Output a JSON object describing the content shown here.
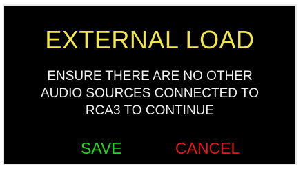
{
  "dialog": {
    "title": "EXTERNAL LOAD",
    "message_lines": [
      "ENSURE THERE ARE NO OTHER",
      "AUDIO SOURCES CONNECTED TO",
      "RCA3 TO CONTINUE"
    ],
    "save_label": "SAVE",
    "cancel_label": "CANCEL"
  },
  "colors": {
    "background": "#000000",
    "title": "#f2e74a",
    "message": "#f0f0f0",
    "save": "#22d522",
    "cancel": "#e41818",
    "border": "#e8e8e8"
  }
}
